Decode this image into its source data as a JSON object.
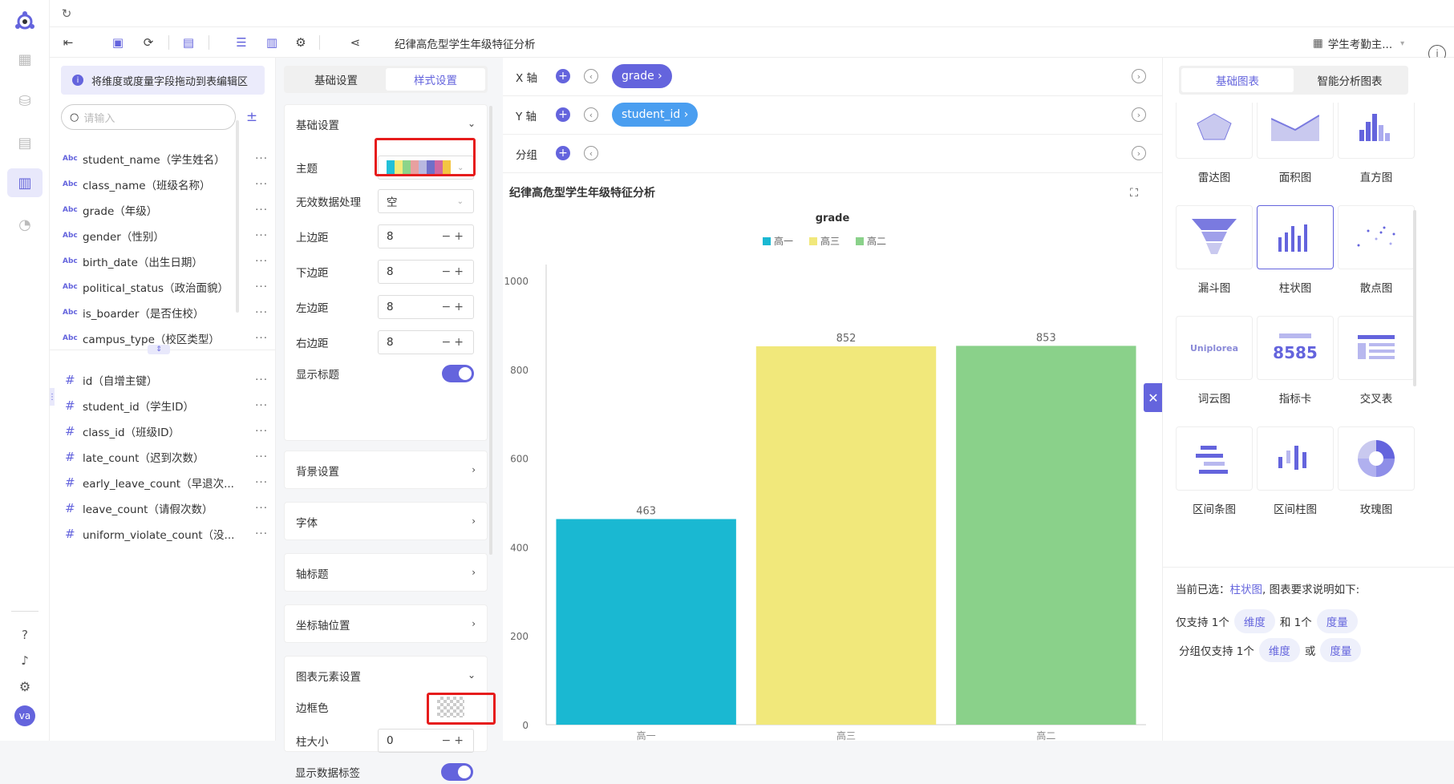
{
  "toolbar": {
    "title": "纪律高危型学生年级特征分析",
    "dataset": "学生考勤主..."
  },
  "fieldpanel": {
    "hint": "将维度或度量字段拖动到表编辑区",
    "search_placeholder": "请输入",
    "dimension_type": "Abc",
    "measure_type": "#",
    "more": "···",
    "dimensions": [
      "student_name（学生姓名）",
      "class_name（班级名称）",
      "grade（年级）",
      "gender（性别）",
      "birth_date（出生日期）",
      "political_status（政治面貌）",
      "is_boarder（是否住校）",
      "campus_type（校区类型）"
    ],
    "measures": [
      "id（自增主键）",
      "student_id（学生ID）",
      "class_id（班级ID）",
      "late_count（迟到次数）",
      "early_leave_count（早退次...",
      "leave_count（请假次数）",
      "uniform_violate_count（没..."
    ]
  },
  "stylepanel": {
    "tab_basic": "基础设置",
    "tab_style": "样式设置",
    "basic_header": "基础设置",
    "theme_label": "主题",
    "invalid_label": "无效数据处理",
    "invalid_value": "空",
    "top_label": "上边距",
    "top_value": "8",
    "bottom_label": "下边距",
    "bottom_value": "8",
    "left_label": "左边距",
    "left_value": "8",
    "right_label": "右边距",
    "right_value": "8",
    "show_title_label": "显示标题",
    "background": "背景设置",
    "font": "字体",
    "axis_title": "轴标题",
    "axis_position": "坐标轴位置",
    "elements_header": "图表元素设置",
    "border_color_label": "边框色",
    "bar_size_label": "柱大小",
    "bar_size_value": "0",
    "show_data_label": "显示数据标签",
    "theme_colors": [
      "#22c0d8",
      "#f3ea7a",
      "#8bd48a",
      "#e8a0a0",
      "#b8b8e0",
      "#6f6fc8",
      "#d068a0",
      "#f4c542"
    ]
  },
  "axes": {
    "x_label": "X 轴",
    "x_field": "grade ›",
    "y_label": "Y 轴",
    "y_field": "student_id ›",
    "group_label": "分组"
  },
  "chart_data": {
    "type": "bar",
    "title": "纪律高危型学生年级特征分析",
    "legend_title": "grade",
    "categories": [
      "高一",
      "高三",
      "高二"
    ],
    "values": [
      463,
      852,
      853
    ],
    "colors": [
      "#1ab8d2",
      "#f1e87b",
      "#8ad18a"
    ],
    "ylim": [
      0,
      1000
    ],
    "yticks": [
      0,
      200,
      400,
      600,
      800,
      1000
    ],
    "legend_position": "top-center",
    "grid": false
  },
  "rightpanel": {
    "tab_basic": "基础图表",
    "tab_smart": "智能分析图表",
    "charts": [
      "雷达图",
      "面积图",
      "直方图",
      "漏斗图",
      "柱状图",
      "散点图",
      "词云图",
      "指标卡",
      "交叉表",
      "区间条图",
      "区间柱图",
      "玫瑰图"
    ],
    "metric_sample": "8585",
    "wordcloud_sample": "Uniplorea",
    "current_prefix": "当前已选：",
    "current_chart": "柱状图",
    "current_suffix": ", 图表要求说明如下:",
    "req1_prefix": "仅支持 1个",
    "dim": "维度",
    "req1_mid": "和 1个",
    "measure": "度量",
    "req2_prefix": "分组仅支持 1个",
    "req2_mid": "或"
  },
  "user": {
    "avatar": "va"
  }
}
